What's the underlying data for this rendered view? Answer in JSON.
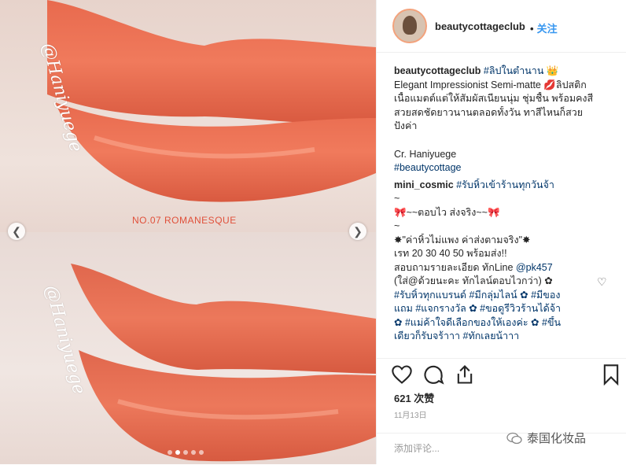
{
  "photo": {
    "caption": "NO.07  ROMANESQUE",
    "watermark": "@Haniyuege",
    "carousel_dots": 5,
    "active_dot": 1
  },
  "header": {
    "username": "beautycottageclub",
    "separator": "•",
    "follow_label": "关注"
  },
  "post": {
    "author": "beautycottageclub",
    "lines": [
      {
        "tag": "#ลิปในตำนาน",
        "text": " 👑"
      },
      {
        "text": "Elegant Impressionist Semi-matte 💋ลิปสติก"
      },
      {
        "text": "เนื้อแมตต์แต่ให้สัมผัสเนียนนุ่ม ชุ่มชื้น พร้อมคงสี"
      },
      {
        "text": "สวยสดชัดยาวนานตลอดทั้งวัน ทาสีไหนก็สวย"
      },
      {
        "text": "ปังค่า"
      }
    ],
    "credit": "Cr. Haniyuege",
    "hashtag": "#beautycottage"
  },
  "comment": {
    "user": "mini_cosmic",
    "first_tag": "#รับหิ้วเข้าร้านทุกวันจ้า",
    "lines": [
      "~",
      "🎀~~ตอบไว ส่งจริง~~🎀",
      "~",
      "✸\"ค่าหิ้วไม่แพง ค่าส่งตามจริง\"✸",
      "เรท 20 30 40 50 พร้อมส่ง!!"
    ],
    "contact_prefix": "สอบถามรายละเอียด ทักLine ",
    "contact_tag": "@pk457",
    "note": "(ใส่@ด้วยนะคะ ทักไลน์ตอบไวกว่า) ✿",
    "tag_lines": [
      "#รับหิ้วทุกแบรนด์ #มีกลุ่มไลน์ ✿ #มีของ",
      "แถม #แจกรางวัล ✿ #ขอดูรีวิวร้านได้จ้า",
      "✿ #แม่ค้าใจดีเลือกของให้เองค่ะ ✿ #ขึ้น",
      "เดียวก็รับจร้าาา #ทักเลยน้าาา"
    ]
  },
  "likes": "621 次赞",
  "date": "11月13日",
  "add_comment_placeholder": "添加评论...",
  "brand_watermark": "泰国化妆品"
}
